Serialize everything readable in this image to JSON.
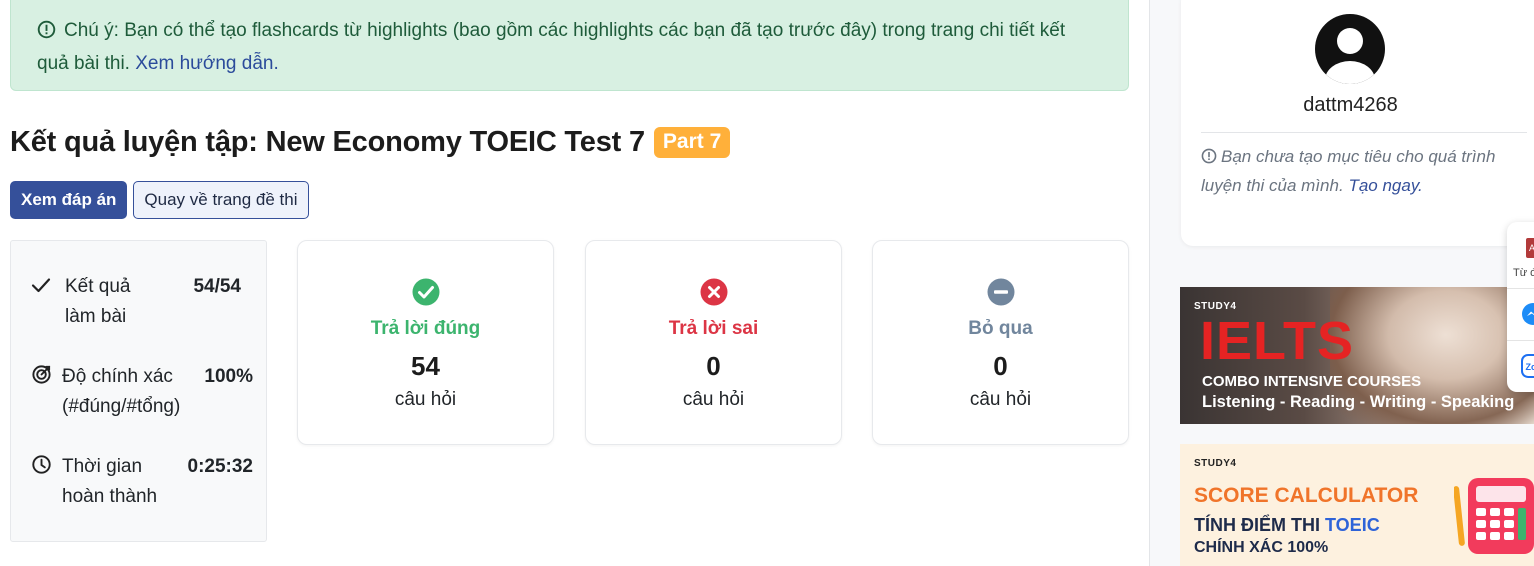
{
  "alert": {
    "text": "Chú ý: Bạn có thể tạo flashcards từ highlights (bao gồm các highlights các bạn đã tạo trước đây) trong trang chi tiết kết quả bài thi.",
    "link": "Xem hướng dẫn."
  },
  "page": {
    "title": "Kết quả luyện tập: New Economy TOEIC Test 7",
    "badge": "Part 7"
  },
  "actions": {
    "view_answers": "Xem đáp án",
    "back_to_test": "Quay về trang đề thi"
  },
  "stats": {
    "result_label_1": "Kết quả",
    "result_label_2": "làm bài",
    "result_value": "54/54",
    "accuracy_label_1": "Độ chính xác",
    "accuracy_label_2": "(#đúng/#tổng)",
    "accuracy_value": "100%",
    "time_label_1": "Thời gian",
    "time_label_2": "hoàn thành",
    "time_value": "0:25:32"
  },
  "results": {
    "correct": {
      "title": "Trả lời đúng",
      "count": "54",
      "unit": "câu hỏi",
      "color": "#3cb46e",
      "icon": "check-circle-icon"
    },
    "wrong": {
      "title": "Trả lời sai",
      "count": "0",
      "unit": "câu hỏi",
      "color": "#dc3545",
      "icon": "x-circle-icon"
    },
    "skipped": {
      "title": "Bỏ qua",
      "count": "0",
      "unit": "câu hỏi",
      "color": "#71869d",
      "icon": "minus-circle-icon"
    }
  },
  "sidebar": {
    "username": "dattm4268",
    "goal_text": "Bạn chưa tạo mục tiêu cho quá trình luyện thi của mình.",
    "goal_link": "Tạo ngay."
  },
  "banners": {
    "ielts": {
      "brand": "STUDY4",
      "headline": "IELTS",
      "combo": "COMBO INTENSIVE COURSES",
      "skills": "Listening - Reading - Writing - Speaking"
    },
    "score": {
      "brand": "STUDY4",
      "headline": "SCORE CALCULATOR",
      "line1_prefix": "TÍNH ĐIỂM THI",
      "line1_highlight": "TOEIC",
      "line2": "CHÍNH XÁC 100%"
    }
  },
  "widget": {
    "label": "Từ đ"
  },
  "colors": {
    "primary": "#35509a",
    "badge": "#ffb03a",
    "alert_bg": "#d8f0e2"
  }
}
